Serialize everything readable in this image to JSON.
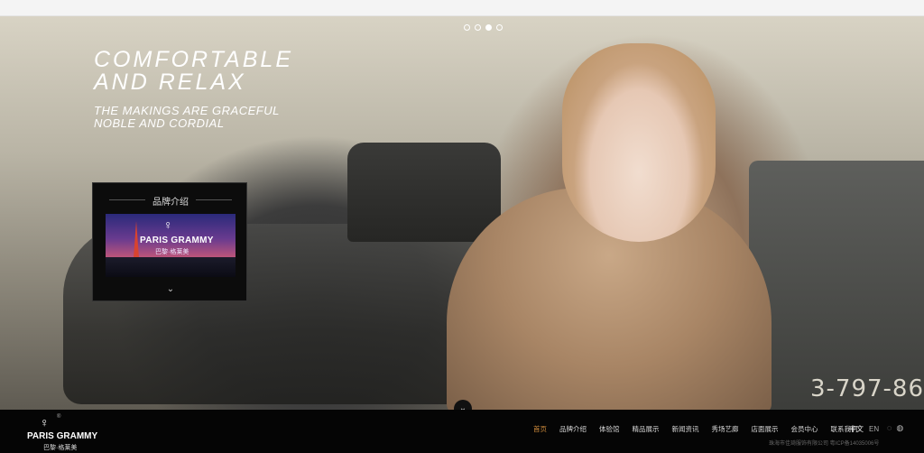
{
  "hero": {
    "headline_line1": "COMFORTABLE",
    "headline_line2": "AND RELAX",
    "subline1": "THE MAKINGS ARE GRACEFUL",
    "subline2": "NOBLE AND CORDIAL",
    "plate_text": "3-797-86",
    "slides": 4,
    "active_slide": 3
  },
  "brand_box": {
    "title": "品牌介绍",
    "logo_text": "PARIS GRAMMY",
    "logo_cn": "巴黎·格莱美",
    "more_icon": "chevron-down-icon"
  },
  "footer": {
    "logo_en": "PARIS GRAMMY",
    "logo_cn": "巴黎·格莱美",
    "logo_reg": "®",
    "nav": [
      {
        "label": "首页",
        "active": true
      },
      {
        "label": "品牌介绍",
        "active": false
      },
      {
        "label": "体验馆",
        "active": false
      },
      {
        "label": "精品展示",
        "active": false
      },
      {
        "label": "新闻资讯",
        "active": false
      },
      {
        "label": "秀场艺廊",
        "active": false
      },
      {
        "label": "店面展示",
        "active": false
      },
      {
        "label": "会员中心",
        "active": false
      },
      {
        "label": "联系我们",
        "active": false
      }
    ],
    "lang": {
      "cn": "中文",
      "en": "EN"
    },
    "icons": [
      "wechat-icon",
      "weibo-icon"
    ],
    "copyright": "珠海市佳琦服饰有限公司 粤ICP备14035006号"
  },
  "colors": {
    "nav_active": "#d08c3c",
    "footer_bg": "#050505"
  }
}
